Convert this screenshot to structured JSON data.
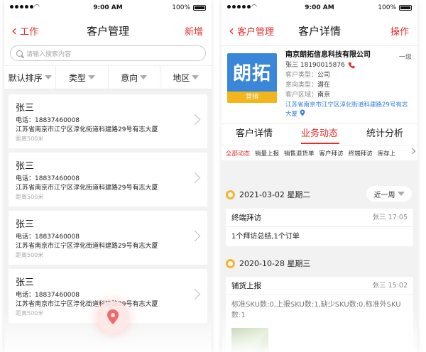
{
  "status_bar": {
    "time": "9:00 AM",
    "battery": "100%",
    "battery_level": 1.0
  },
  "left": {
    "nav": {
      "back_label": "工作",
      "title": "客户管理",
      "action_label": "新增"
    },
    "search": {
      "placeholder": "请输入搜索内容"
    },
    "filters": [
      "默认排序",
      "类型",
      "意向",
      "地区"
    ],
    "customers": [
      {
        "name": "张三",
        "phone": "电话：18837460008",
        "address": "江苏省南京市江宁区淳化街道科建路29号有志大厦",
        "distance": "距离500米"
      },
      {
        "name": "张三",
        "phone": "电话：18837460008",
        "address": "江苏省南京市江宁区淳化街道科建路29号有志大厦",
        "distance": "距离500米"
      },
      {
        "name": "张三",
        "phone": "电话：18837460008",
        "address": "江苏省南京市江宁区淳化街道科建路29号有志大厦",
        "distance": "距离500米"
      },
      {
        "name": "张三",
        "phone": "电话：18837460008",
        "address": "江苏省南京市江宁区淳化街道科建路29号有志大厦",
        "distance": "距离500米"
      }
    ],
    "fab_icon": "map-pin-icon"
  },
  "right": {
    "nav": {
      "back_label": "客户管理",
      "title": "客户详情",
      "action_label": "操作"
    },
    "profile": {
      "logo_text": "朗拓",
      "logo_sub": "营销",
      "company": "南京朗拓信息科技有限公司",
      "level": "一级",
      "contact": "张三 18190015876",
      "type_key": "客户类型：",
      "type_val": "公司",
      "intent_key": "意向类型：",
      "intent_val": "潜在",
      "region_key": "客户区域：",
      "region_val": "南京",
      "address": "江苏省南京市江宁区淳化街道科建路29号有志大厦"
    },
    "tabs": [
      "客户详情",
      "业务动态",
      "统计分析"
    ],
    "active_tab": "业务动态",
    "subtabs": [
      "全部动态",
      "销量上报",
      "销售退货单",
      "客户拜访",
      "终端拜访",
      "库存上"
    ],
    "groups": [
      {
        "date": "2021-03-02 星期二",
        "period": "近一周",
        "record": {
          "type": "终端拜访",
          "who_time": "张三 17:05",
          "content": "1个拜访总结,1个订单"
        }
      },
      {
        "date": "2020-10-28 星期三",
        "record": {
          "type": "铺货上报",
          "who_time": "张三 15:02",
          "content": "标准SKU数:0,上报SKU数:1,缺少SKU数:0,标准外SKU数:1"
        }
      }
    ]
  },
  "colors": {
    "accent": "#e0302e",
    "link": "#2f7de1",
    "logo_blue": "#3a86d8",
    "logo_yellow": "#f2b51c"
  }
}
